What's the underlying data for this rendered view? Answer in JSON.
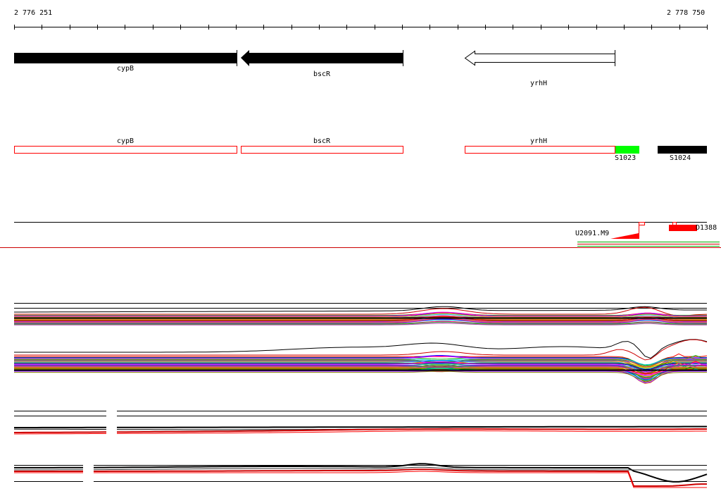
{
  "coords": {
    "start": "2 776 251",
    "end": "2 778 750"
  },
  "genes": [
    {
      "name": "cypB",
      "strand": "-",
      "filled": true
    },
    {
      "name": "bscR",
      "strand": "-",
      "filled": true
    },
    {
      "name": "yrhH",
      "strand": "-",
      "filled": false
    }
  ],
  "features": [
    {
      "name": "cypB",
      "color": "#ff0000"
    },
    {
      "name": "bscR",
      "color": "#ff0000"
    },
    {
      "name": "yrhH",
      "color": "#ff0000"
    }
  ],
  "segments": [
    {
      "name": "S1023",
      "color": "#00ff00"
    },
    {
      "name": "S1024",
      "color": "#000000"
    }
  ],
  "transcripts": [
    {
      "name": "U2091.M9"
    },
    {
      "name": "D1388"
    }
  ],
  "colors": {
    "axis": "#000000",
    "accent_red": "#ff0000",
    "accent_green": "#00cc00",
    "divider": "#cc0000"
  }
}
